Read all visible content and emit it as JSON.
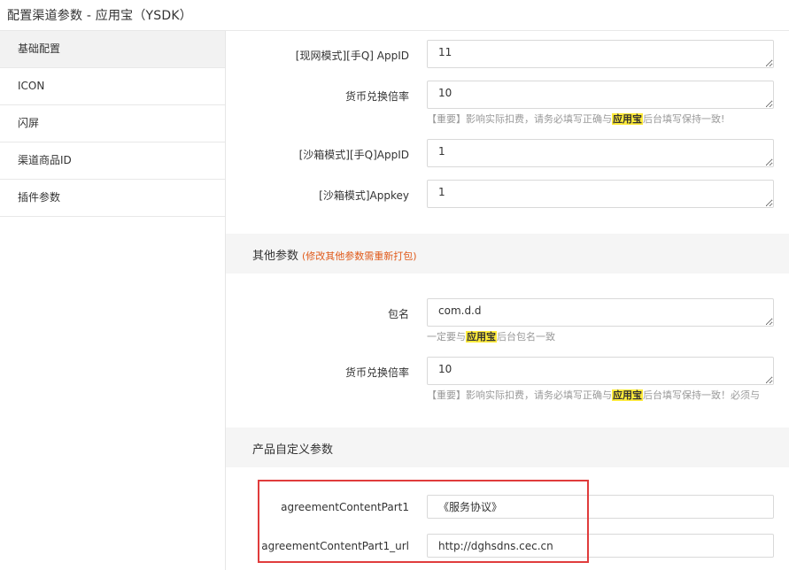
{
  "window": {
    "title": "配置渠道参数 - 应用宝（YSDK）"
  },
  "sidebar": {
    "items": [
      {
        "label": "基础配置"
      },
      {
        "label": "ICON"
      },
      {
        "label": "闪屏"
      },
      {
        "label": "渠道商品ID"
      },
      {
        "label": "插件参数"
      }
    ]
  },
  "basic": {
    "appid_live": {
      "label": "[现网模式][手Q] AppID",
      "value": "11"
    },
    "currency_rate": {
      "label": "货币兑换倍率",
      "value": "10",
      "hint_pre": "【重要】影响实际扣费，请务必填写正确与",
      "hint_hl": "应用宝",
      "hint_post": "后台填写保持一致!"
    },
    "appid_sandbox": {
      "label": "[沙箱模式][手Q]AppID",
      "value": "1"
    },
    "appkey_sandbox": {
      "label": "[沙箱模式]Appkey",
      "value": "1"
    }
  },
  "other": {
    "title": "其他参数",
    "note": "(修改其他参数需重新打包)",
    "package": {
      "label": "包名",
      "value": "com.d.d",
      "hint_pre": "一定要与",
      "hint_hl": "应用宝",
      "hint_post": "后台包名一致"
    },
    "currency_rate": {
      "label": "货币兑换倍率",
      "value": "10",
      "hint_pre": "【重要】影响实际扣费，请务必填写正确与",
      "hint_hl": "应用宝",
      "hint_post": "后台填写保持一致！必须与"
    }
  },
  "product": {
    "title": "产品自定义参数",
    "agreement": {
      "label": "agreementContentPart1",
      "value": "《服务协议》"
    },
    "agreement_url": {
      "label": "agreementContentPart1_url",
      "value": "http://dghsdns.cec.cn"
    }
  },
  "colors": {
    "highlight": "#ffeb3b",
    "note": "#e05a1a",
    "annotation_box": "#e03c3c",
    "active_nav": "#f2f2f2"
  }
}
